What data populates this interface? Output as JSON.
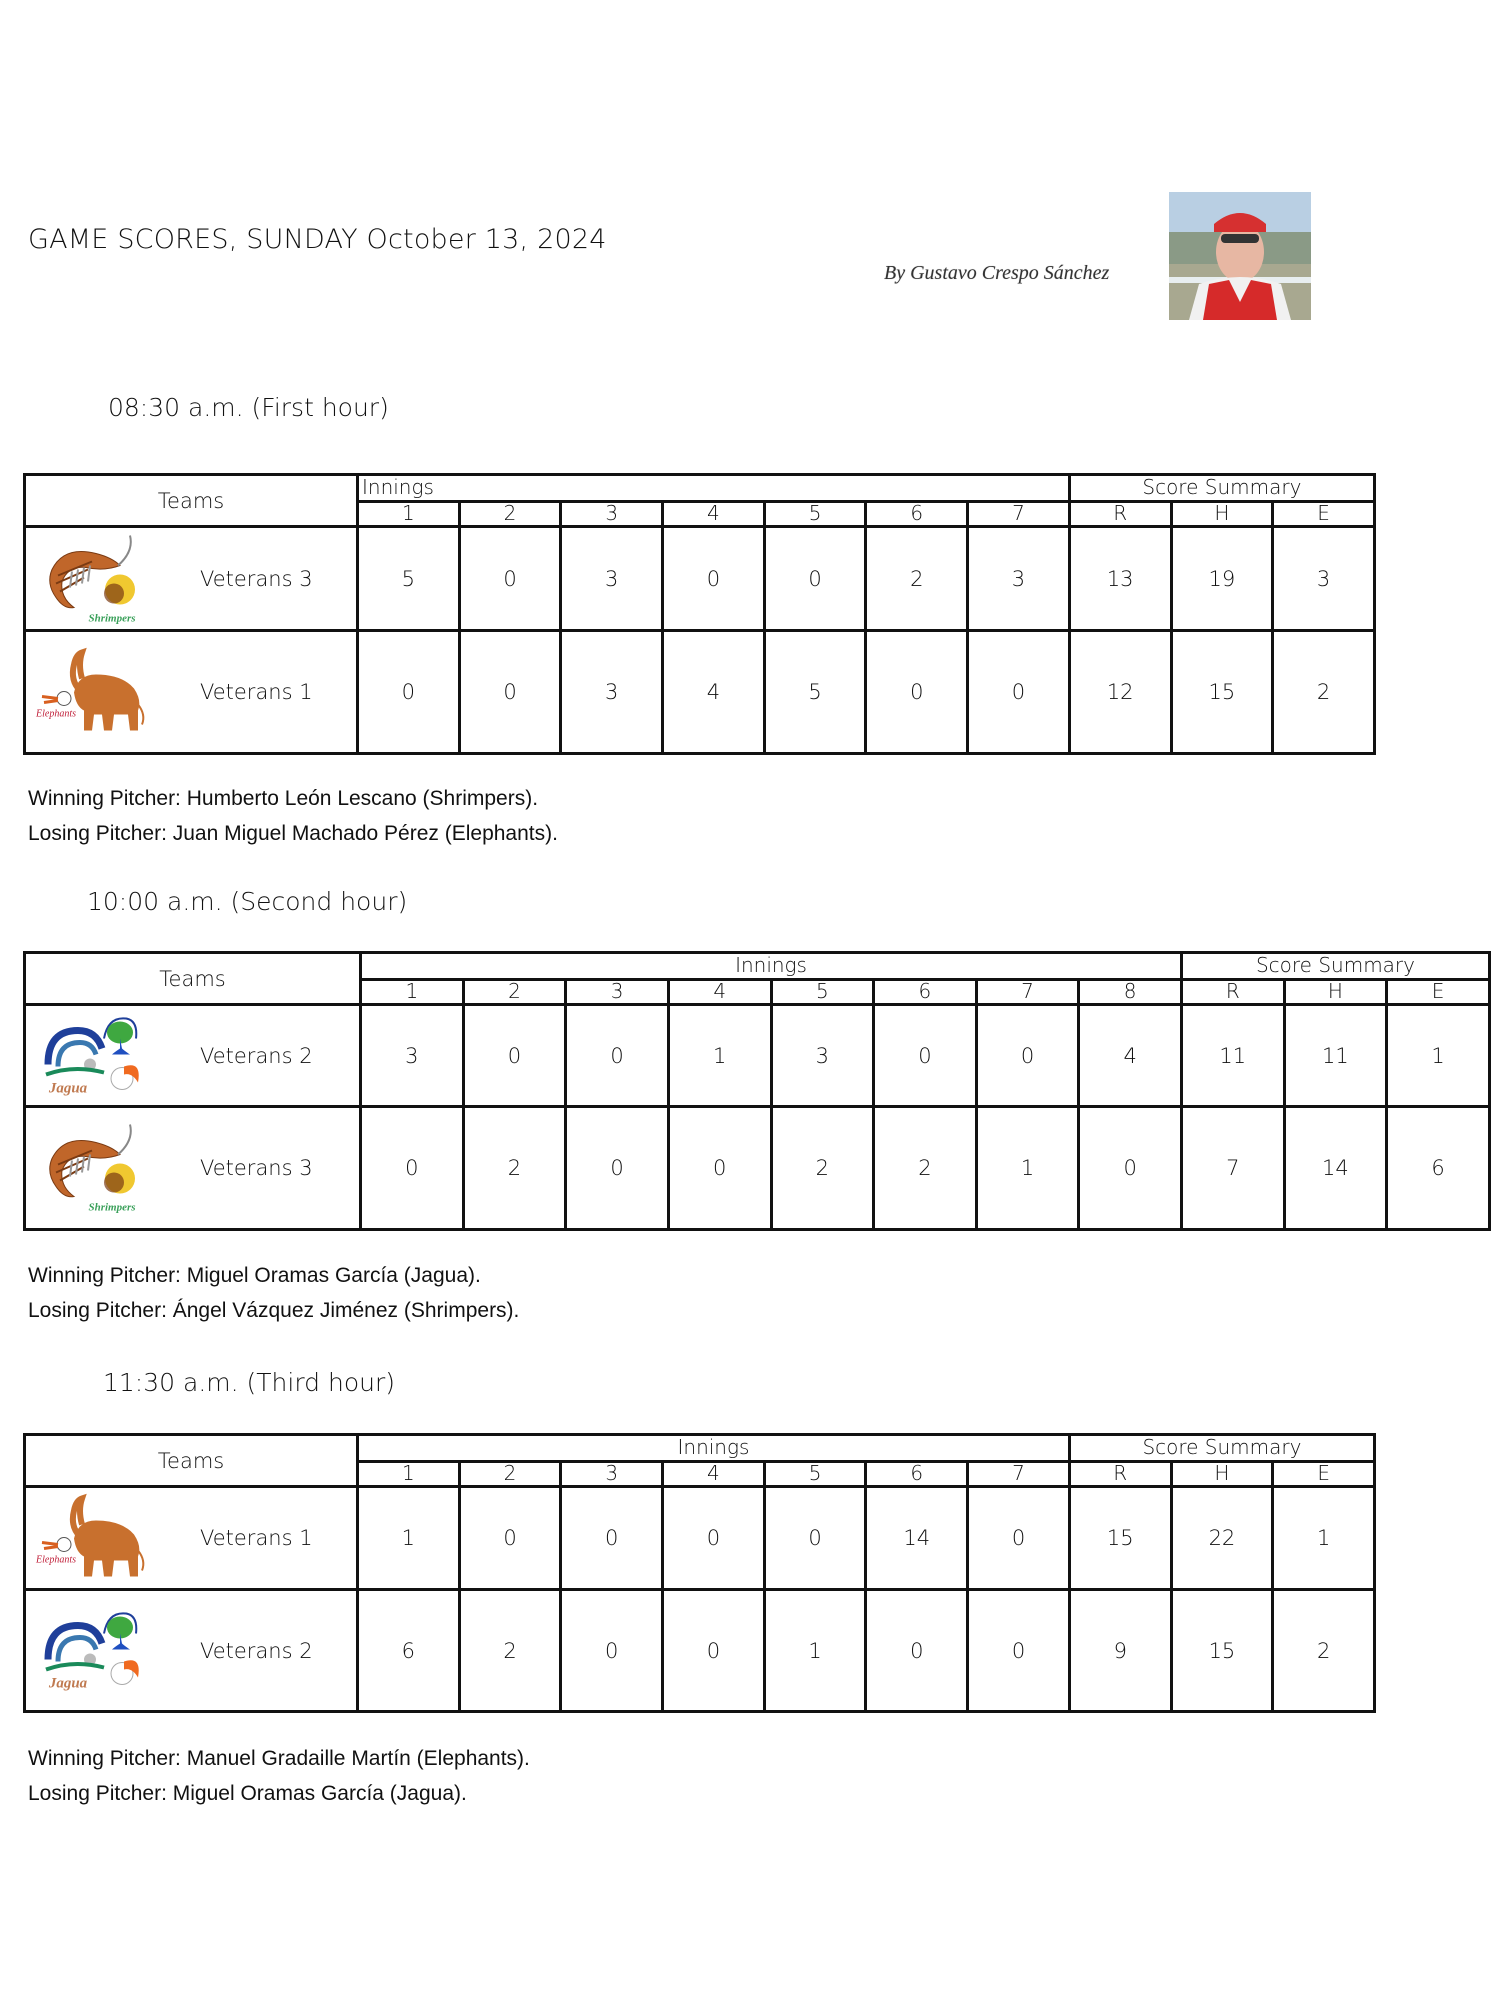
{
  "header": {
    "title": "GAME SCORES, SUNDAY October 13, 2024",
    "byline": "By Gustavo Crespo Sánchez",
    "author_photo": "author-photo"
  },
  "labels": {
    "teams": "Teams",
    "innings": "Innings",
    "score_summary": "Score Summary",
    "runs": "R",
    "hits": "H",
    "errors": "E",
    "winning_pitcher_prefix": "Winning Pitcher:",
    "losing_pitcher_prefix": "Losing Pitcher:"
  },
  "games": [
    {
      "heading": "08:30 a.m. (First hour)",
      "innings": [
        "1",
        "2",
        "3",
        "4",
        "5",
        "6",
        "7"
      ],
      "teams": [
        {
          "logo": "shrimpers-logo",
          "logo_text": "Shrimpers",
          "name": "Veterans 3",
          "innings": [
            "5",
            "0",
            "3",
            "0",
            "0",
            "2",
            "3"
          ],
          "R": "13",
          "H": "19",
          "E": "3"
        },
        {
          "logo": "elephants-logo",
          "logo_text": "Elephants",
          "name": "Veterans 1",
          "innings": [
            "0",
            "0",
            "3",
            "4",
            "5",
            "0",
            "0"
          ],
          "R": "12",
          "H": "15",
          "E": "2"
        }
      ],
      "winning_pitcher": "Winning Pitcher: Humberto León Lescano (Shrimpers).",
      "losing_pitcher": "Losing Pitcher: Juan Miguel Machado Pérez (Elephants)."
    },
    {
      "heading": "10:00 a.m. (Second hour)",
      "innings": [
        "1",
        "2",
        "3",
        "4",
        "5",
        "6",
        "7",
        "8"
      ],
      "teams": [
        {
          "logo": "jagua-logo",
          "logo_text": "Jagua",
          "name": "Veterans 2",
          "innings": [
            "3",
            "0",
            "0",
            "1",
            "3",
            "0",
            "0",
            "4"
          ],
          "R": "11",
          "H": "11",
          "E": "1"
        },
        {
          "logo": "shrimpers-logo",
          "logo_text": "Shrimpers",
          "name": "Veterans 3",
          "innings": [
            "0",
            "2",
            "0",
            "0",
            "2",
            "2",
            "1",
            "0"
          ],
          "R": "7",
          "H": "14",
          "E": "6"
        }
      ],
      "winning_pitcher": "Winning Pitcher: Miguel Oramas García (Jagua).",
      "losing_pitcher": "Losing Pitcher: Ángel Vázquez Jiménez (Shrimpers)."
    },
    {
      "heading": "11:30 a.m. (Third hour)",
      "innings": [
        "1",
        "2",
        "3",
        "4",
        "5",
        "6",
        "7"
      ],
      "teams": [
        {
          "logo": "elephants-logo",
          "logo_text": "Elephants",
          "name": "Veterans 1",
          "innings": [
            "1",
            "0",
            "0",
            "0",
            "0",
            "14",
            "0"
          ],
          "R": "15",
          "H": "22",
          "E": "1"
        },
        {
          "logo": "jagua-logo",
          "logo_text": "Jagua",
          "name": "Veterans 2",
          "innings": [
            "6",
            "2",
            "0",
            "0",
            "1",
            "0",
            "0"
          ],
          "R": "9",
          "H": "15",
          "E": "2"
        }
      ],
      "winning_pitcher": "Winning Pitcher: Manuel Gradaille Martín (Elephants).",
      "losing_pitcher": "Losing Pitcher: Miguel Oramas García (Jagua)."
    }
  ]
}
